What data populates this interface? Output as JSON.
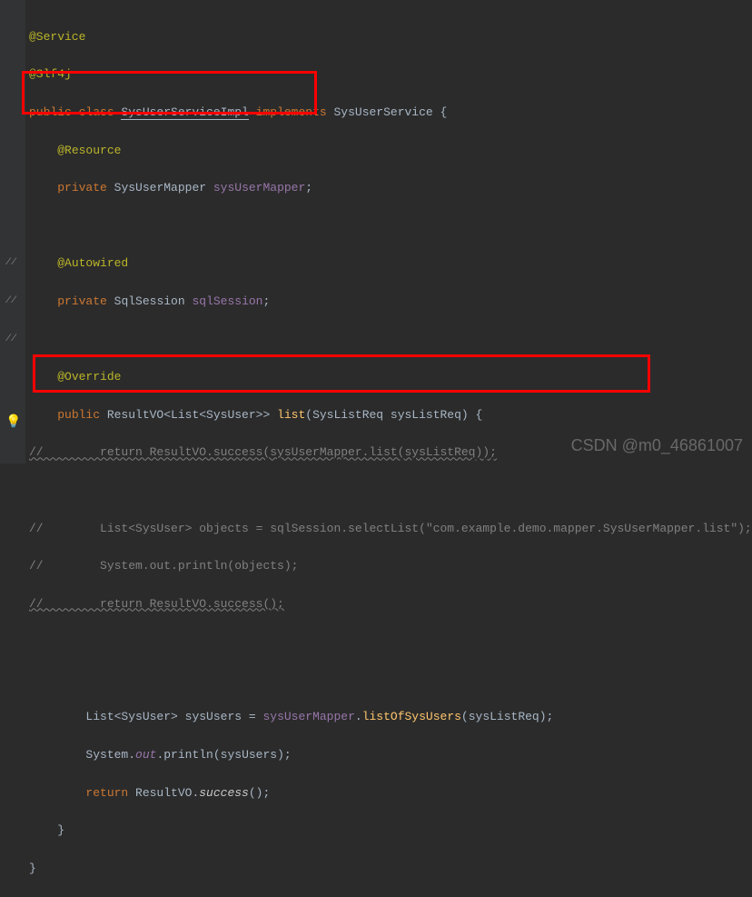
{
  "line1": {
    "annotation": "@Service"
  },
  "line2": {
    "annotation": "@Slf4j"
  },
  "line3": {
    "kw1": "public ",
    "kw2": "class ",
    "cls": "SysUserServiceImpl",
    "kw3": " implements ",
    "iface": "SysUserService",
    "brace": " {"
  },
  "line4": {
    "indent": "    ",
    "annotation": "@Resource"
  },
  "line5": {
    "indent": "    ",
    "kw": "private ",
    "type": "SysUserMapper ",
    "field": "sysUserMapper",
    "semi": ";"
  },
  "line6": {
    "blank": ""
  },
  "line7": {
    "indent": "    ",
    "annotation": "@Autowired"
  },
  "line8": {
    "indent": "    ",
    "kw": "private ",
    "type": "SqlSession ",
    "field": "sqlSession",
    "semi": ";"
  },
  "line9": {
    "blank": ""
  },
  "line10": {
    "indent": "    ",
    "annotation": "@Override"
  },
  "line11": {
    "indent": "    ",
    "kw1": "public ",
    "ret": "ResultVO<List<SysUser>> ",
    "method": "list",
    "sig": "(SysListReq sysListReq) {"
  },
  "line12": {
    "comment": "//        return ResultVO.success(sysUserMapper.list(sysListReq));"
  },
  "line13": {
    "blank": ""
  },
  "line14": {
    "comment": "//        List<SysUser> objects = sqlSession.selectList(\"com.example.demo.mapper.SysUserMapper.list\");"
  },
  "line15": {
    "comment": "//        System.out.println(objects);"
  },
  "line16": {
    "comment": "//        return ResultVO.success();"
  },
  "line17": {
    "blank": ""
  },
  "line18": {
    "blank": ""
  },
  "line19": {
    "indent": "        ",
    "type": "List<SysUser> ",
    "var": "sysUsers",
    "eq": " = ",
    "field": "sysUserMapper",
    "dot": ".",
    "method": "listOfSysUsers",
    "args": "(sysListReq);"
  },
  "line20": {
    "indent": "        ",
    "sys": "System.",
    "out": "out",
    "dot": ".",
    "println": "println",
    "args": "(sysUsers);"
  },
  "line21": {
    "indent": "        ",
    "kw": "return ",
    "cls": "ResultVO.",
    "method": "success",
    "args": "();"
  },
  "line22": {
    "indent": "    ",
    "brace": "}"
  },
  "line23": {
    "brace": "}"
  },
  "watermark": "CSDN @m0_46861007"
}
